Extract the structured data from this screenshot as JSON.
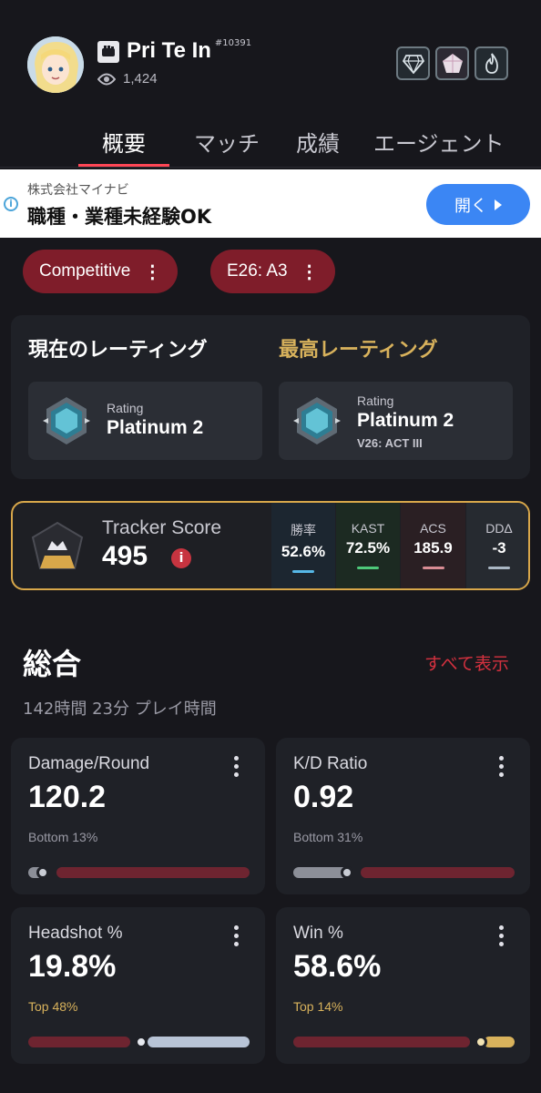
{
  "profile": {
    "name": "Pri Te In",
    "tag": "#10391",
    "views": "1,424"
  },
  "tabs": [
    "概要",
    "マッチ",
    "成績",
    "エージェント"
  ],
  "ad": {
    "sponsor": "株式会社マイナビ",
    "headline": "職種・業種未経験OK",
    "button": "開く",
    "info": "i"
  },
  "filters": {
    "mode": "Competitive",
    "season": "E26: A3"
  },
  "rating": {
    "current_title": "現在のレーティング",
    "peak_title": "最高レーティング",
    "current": {
      "label": "Rating",
      "rank": "Platinum 2"
    },
    "peak": {
      "label": "Rating",
      "rank": "Platinum 2",
      "act": "V26: ACT III"
    }
  },
  "tracker": {
    "label": "Tracker Score",
    "value": "495",
    "stats": [
      {
        "label": "勝率",
        "value": "52.6%",
        "color": "#56b7e6"
      },
      {
        "label": "KAST",
        "value": "72.5%",
        "color": "#4ec97a"
      },
      {
        "label": "ACS",
        "value": "185.9",
        "color": "#d98c94"
      },
      {
        "label": "DDΔ",
        "value": "-3",
        "color": "#aab7c4"
      }
    ]
  },
  "overview": {
    "title": "総合",
    "see_all": "すべて表示",
    "playtime": "142時間 23分 プレイ時間"
  },
  "stat_cards": [
    {
      "title": "Damage/Round",
      "value": "120.2",
      "percentile": "Bottom 13%",
      "percentile_color": "#9a9aa5",
      "fill": 0.13
    },
    {
      "title": "K/D Ratio",
      "value": "0.92",
      "percentile": "Bottom 31%",
      "percentile_color": "#9a9aa5",
      "fill": 0.31
    },
    {
      "title": "Headshot %",
      "value": "19.8%",
      "percentile": "Top 48%",
      "percentile_color": "#d8b25c",
      "fill": 0.52
    },
    {
      "title": "Win %",
      "value": "58.6%",
      "percentile": "Top 14%",
      "percentile_color": "#d8b25c",
      "fill": 0.86
    }
  ],
  "colors": {
    "accent_red": "#ff4655",
    "pill_bg": "#7f1d2a",
    "gold": "#d8a74a"
  }
}
